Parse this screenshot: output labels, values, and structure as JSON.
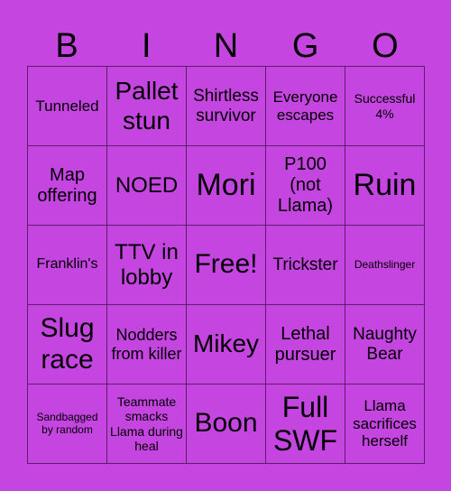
{
  "header": [
    "B",
    "I",
    "N",
    "G",
    "O"
  ],
  "cells": [
    "Tunneled",
    "Pallet stun",
    "Shirtless survivor",
    "Everyone escapes",
    "Successful 4%",
    "Map offering",
    "NOED",
    "Mori",
    "P100 (not Llama)",
    "Ruin",
    "Franklin's",
    "TTV in lobby",
    "Free!",
    "Trickster",
    "Deathslinger",
    "Slug race",
    "Nodders from killer",
    "Mikey",
    "Lethal pursuer",
    "Naughty Bear",
    "Sandbagged by random",
    "Teammate smacks Llama during heal",
    "Boon",
    "Full SWF",
    "Llama sacrifices herself"
  ],
  "colors": {
    "background": "#c545e0",
    "grid_line": "#5a1f66",
    "text": "#000000"
  }
}
